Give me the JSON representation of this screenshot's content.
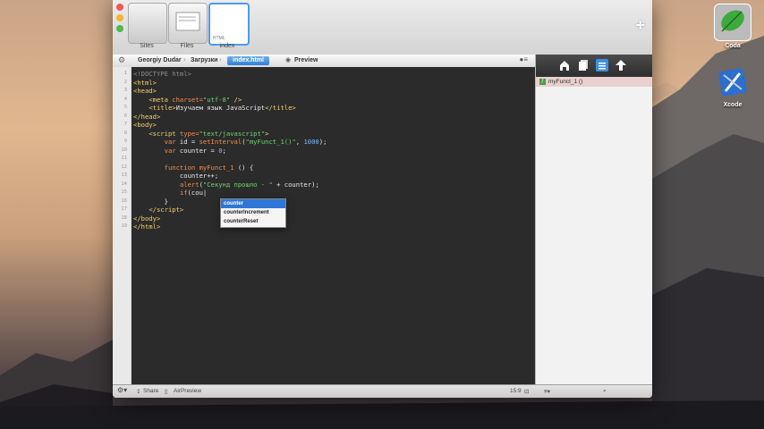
{
  "window": {
    "sites": [
      {
        "label": "Sites"
      },
      {
        "label": "Files"
      },
      {
        "label": "index",
        "badge": "HTML"
      }
    ],
    "add_label": "+"
  },
  "pathbar": {
    "crumbs": [
      "Georgiy Dudar",
      "Загрузки",
      "index.html"
    ],
    "preview_label": "Preview"
  },
  "editor": {
    "line_numbers": [
      "1",
      "2",
      "3",
      "4",
      "5",
      "6",
      "7",
      "8",
      "9",
      "10",
      "11",
      "12",
      "13",
      "14",
      "15",
      "16",
      "17",
      "18",
      "19"
    ],
    "autocomplete": [
      "counter",
      "counterIncrement",
      "counterReset"
    ]
  },
  "sidebar": {
    "function_item": "myFunct_1 ()"
  },
  "status": {
    "share": "Share",
    "airpreview": "AirPreview",
    "position": "15:9"
  },
  "desktop": {
    "icons": [
      {
        "label": "Coda"
      },
      {
        "label": "Xcode"
      }
    ]
  },
  "colors": {
    "editor_bg": "#2b2b2b",
    "tag": "#f4d26b",
    "attribute": "#f08f4a",
    "string": "#6fd36f",
    "number": "#7db8ff",
    "selection": "#2f76d6"
  }
}
